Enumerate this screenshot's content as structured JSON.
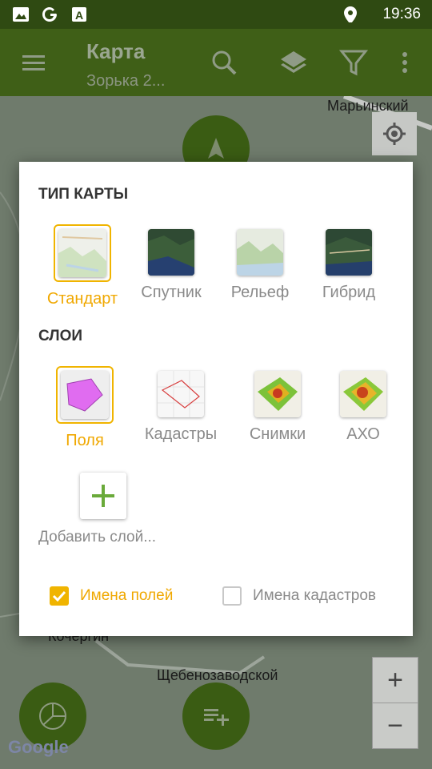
{
  "status_bar": {
    "time": "19:36"
  },
  "app_bar": {
    "title": "Карта",
    "subtitle": "Зорька 2..."
  },
  "map": {
    "labels": [
      "Марьинский",
      "Кочергин",
      "Щебенозаводской"
    ],
    "google": "Google",
    "zoom_in": "+",
    "zoom_out": "−"
  },
  "dialog": {
    "map_type_title": "ТИП КАРТЫ",
    "map_types": [
      {
        "label": "Стандарт",
        "selected": true
      },
      {
        "label": "Спутник",
        "selected": false
      },
      {
        "label": "Рельеф",
        "selected": false
      },
      {
        "label": "Гибрид",
        "selected": false
      }
    ],
    "layers_title": "СЛОИ",
    "layers": [
      {
        "label": "Поля",
        "selected": true
      },
      {
        "label": "Кадастры",
        "selected": false
      },
      {
        "label": "Снимки",
        "selected": false
      },
      {
        "label": "АХО",
        "selected": false
      }
    ],
    "add_layer": "Добавить слой...",
    "checkboxes": [
      {
        "label": "Имена полей",
        "checked": true
      },
      {
        "label": "Имена кадастров",
        "checked": false
      }
    ]
  },
  "colors": {
    "accent": "#f0b400",
    "app_bar": "#3f5f17",
    "status_bar": "#2f4a12",
    "green_plus": "#6aaa3a"
  }
}
